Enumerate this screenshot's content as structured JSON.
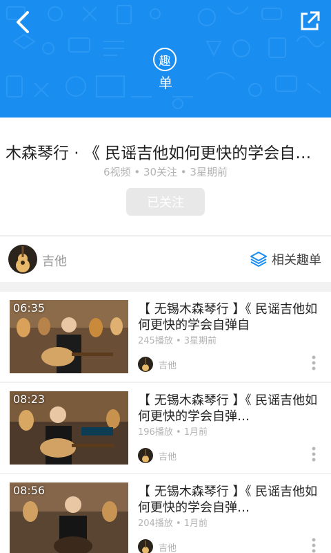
{
  "header": {
    "badge_char": "趣",
    "badge_sub": "单",
    "back_icon": "back-arrow-icon",
    "share_icon": "share-external-icon",
    "color": "#1a8df0"
  },
  "playlist": {
    "title": "木森琴行 · 《 民谣吉他如何更快的学会自…",
    "meta": "6视频 • 30关注 • 3星期前",
    "follow_label": "已关注"
  },
  "category_row": {
    "label": "吉他",
    "related_label": "相关趣单",
    "related_icon": "layers-icon",
    "accent": "#1a8df0"
  },
  "videos": [
    {
      "duration": "06:35",
      "title": "【 无锡木森琴行 】《 民谣吉他如何更快的学会自弹自",
      "stats": "245播放 • 3星期前",
      "category": "吉他"
    },
    {
      "duration": "08:23",
      "title": "【 无锡木森琴行 】《 民谣吉他如何更快的学会自弹…",
      "stats": "196播放 • 1月前",
      "category": "吉他"
    },
    {
      "duration": "08:56",
      "title": "【 无锡木森琴行 】《 民谣吉他如何更快的学会自弹…",
      "stats": "204播放 • 1月前",
      "category": "吉他"
    }
  ]
}
